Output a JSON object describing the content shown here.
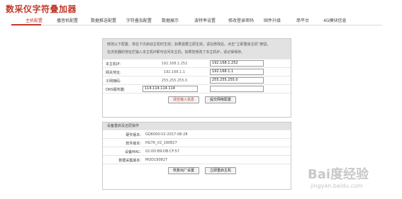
{
  "app": {
    "title": "数采仪字符叠加器"
  },
  "tabs": [
    {
      "label": "主机配置",
      "active": true
    },
    {
      "label": "播音机配置",
      "active": false
    },
    {
      "label": "数据推送配置",
      "active": false
    },
    {
      "label": "字符叠加配置",
      "active": false
    },
    {
      "label": "数据展示",
      "active": false
    },
    {
      "label": "波特率设置",
      "active": false
    },
    {
      "label": "修改登录密码",
      "active": false
    },
    {
      "label": "固件升级",
      "active": false
    },
    {
      "label": "串平台",
      "active": false
    },
    {
      "label": "4G模块信息",
      "active": false
    }
  ],
  "network": {
    "notice": [
      "修改以下配置，将在下次启动主机时生效；如果需要立即生效，请在修改后，点击“立即重启主机”按钮。",
      "在浏览器的地址栏输入本主机IP即可访问本主机，如果您修改了本主机IP，请记得保存。"
    ],
    "fields": [
      {
        "label": "本主机IP:",
        "current": "192.168.1.252",
        "value": "192.168.1.252"
      },
      {
        "label": "网关地址:",
        "current": "192.168.1.1",
        "value": "192.168.1.1"
      },
      {
        "label": "子网掩码:",
        "current": "255.255.255.0",
        "value": "255.255.255.0"
      }
    ],
    "dns": {
      "label": "DNS服务器:",
      "value1": "114.114.114.114",
      "value2": ""
    },
    "clear_button": "清空输入信息",
    "submit_button": "提交网络配置"
  },
  "device": {
    "header": "设备重启及还原操作",
    "rows": [
      {
        "label": "硬件版本:",
        "value": "GQ6000-V2-2017-08-28"
      },
      {
        "label": "软件版本:",
        "value": "HG76_V2_190827"
      },
      {
        "label": "设备MAC:",
        "value": "02:0D:B9:DB:CF:57"
      },
      {
        "label": "数据采集版本:",
        "value": "MOD190827"
      }
    ],
    "factory_button": "恢复出厂设置",
    "reboot_button": "立即重启主机"
  },
  "watermark": {
    "logo": "Bai度经验",
    "sub": "jingyan.baidu.com"
  }
}
